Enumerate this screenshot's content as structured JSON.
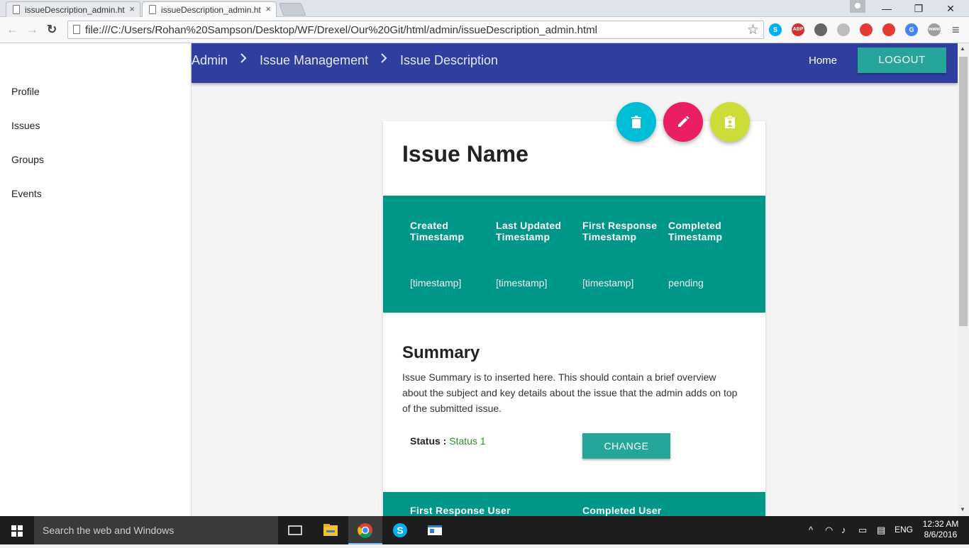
{
  "browser": {
    "tabs": [
      {
        "title": "issueDescription_admin.ht",
        "active": false
      },
      {
        "title": "issueDescription_admin.ht",
        "active": true
      }
    ],
    "url": "file:///C:/Users/Rohan%20Sampson/Desktop/WF/Drexel/Our%20Git/html/admin/issueDescription_admin.html",
    "extensions": [
      {
        "name": "skype-icon",
        "color": "#00aff0",
        "label": "S"
      },
      {
        "name": "adblock-icon",
        "color": "#d32f2f",
        "label": "ABP"
      },
      {
        "name": "lightbulb-icon",
        "color": "#666666",
        "label": ""
      },
      {
        "name": "refresh-ext-icon",
        "color": "#bdbdbd",
        "label": ""
      },
      {
        "name": "blocked-icon",
        "color": "#e53935",
        "label": ""
      },
      {
        "name": "record-icon",
        "color": "#e53935",
        "label": ""
      },
      {
        "name": "translate-icon",
        "color": "#4285f4",
        "label": "G"
      },
      {
        "name": "www-icon",
        "color": "#9e9e9e",
        "label": "www"
      }
    ]
  },
  "sidebar": {
    "items": [
      {
        "label": "Profile"
      },
      {
        "label": "Issues"
      },
      {
        "label": "Groups"
      },
      {
        "label": "Events"
      }
    ]
  },
  "header": {
    "breadcrumbs": [
      "Admin",
      "Issue Management",
      "Issue Description"
    ],
    "separator": ">",
    "home_label": "Home",
    "logout_label": "LOGOUT"
  },
  "issue": {
    "name": "Issue Name",
    "actions": [
      {
        "name": "delete",
        "icon": "trash-icon",
        "color": "#00bcd4"
      },
      {
        "name": "edit",
        "icon": "pencil-icon",
        "color": "#e91e63"
      },
      {
        "name": "assign",
        "icon": "clipboard-user-icon",
        "color": "#cddc39"
      }
    ],
    "timestamps": {
      "headers": [
        "Created Timestamp",
        "Last Updated Timestamp",
        "First Response Timestamp",
        "Completed Timestamp"
      ],
      "values": [
        "[timestamp]",
        "[timestamp]",
        "[timestamp]",
        "pending"
      ]
    },
    "summary_title": "Summary",
    "summary_text": "Issue Summary is to inserted here. This should contain a brief overview about the subject and key details about the issue that the admin adds on top of the submitted issue.",
    "status_label": "Status :",
    "status_value": "Status 1",
    "change_label": "CHANGE",
    "users": {
      "headers": [
        "First Response User",
        "Completed User"
      ]
    }
  },
  "taskbar": {
    "search_placeholder": "Search the web and Windows",
    "language": "ENG",
    "time": "12:32 AM",
    "date": "8/6/2016"
  },
  "colors": {
    "header": "#303f9f",
    "teal": "#009688",
    "button": "#26a69a",
    "status": "#2e8b2e"
  }
}
